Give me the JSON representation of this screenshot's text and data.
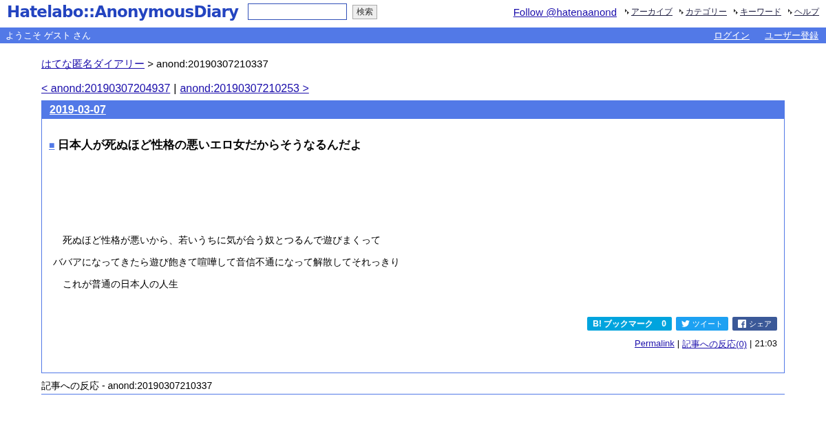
{
  "header": {
    "logo": "Hatelabo::AnonymousDiary",
    "search": {
      "button": "検索"
    },
    "follow": "Follow @hatenaanond",
    "nav": [
      "アーカイブ",
      "カテゴリー",
      "キーワード",
      "ヘルプ"
    ]
  },
  "userbar": {
    "welcome": "ようこそ ゲスト さん",
    "links": [
      "ログイン",
      "ユーザー登録"
    ]
  },
  "breadcrumb": {
    "home": "はてな匿名ダイアリー",
    "current": "> anond:20190307210337"
  },
  "pager": {
    "prev": "< anond:20190307204937",
    "separator": "|",
    "next": "anond:20190307210253 >"
  },
  "entry": {
    "date": "2019-03-07",
    "mark": "■",
    "title": "日本人が死ぬほど性格の悪いエロ女だからそうなるんだよ",
    "paragraphs": [
      {
        "text": "死ぬほど性格が悪いから、若いうちに気が合う奴とつるんで遊びまくって",
        "indent": true
      },
      {
        "text": "ババアになってきたら遊び飽きて喧嘩して音信不通になって解散してそれっきり",
        "indent": false
      },
      {
        "text": "これが普通の日本人の人生",
        "indent": true
      }
    ],
    "share": [
      {
        "kind": "bookmark",
        "label": "B! ブックマーク",
        "count": "0"
      },
      {
        "kind": "tweet",
        "label": "ツイート"
      },
      {
        "kind": "share",
        "label": "シェア"
      }
    ],
    "footer": {
      "permalink": "Permalink",
      "sep1": "|",
      "reactions": "記事への反応(0)",
      "sep2": "|",
      "time": "21:03"
    }
  },
  "reactions_heading": "記事への反応 - anond:20190307210337"
}
